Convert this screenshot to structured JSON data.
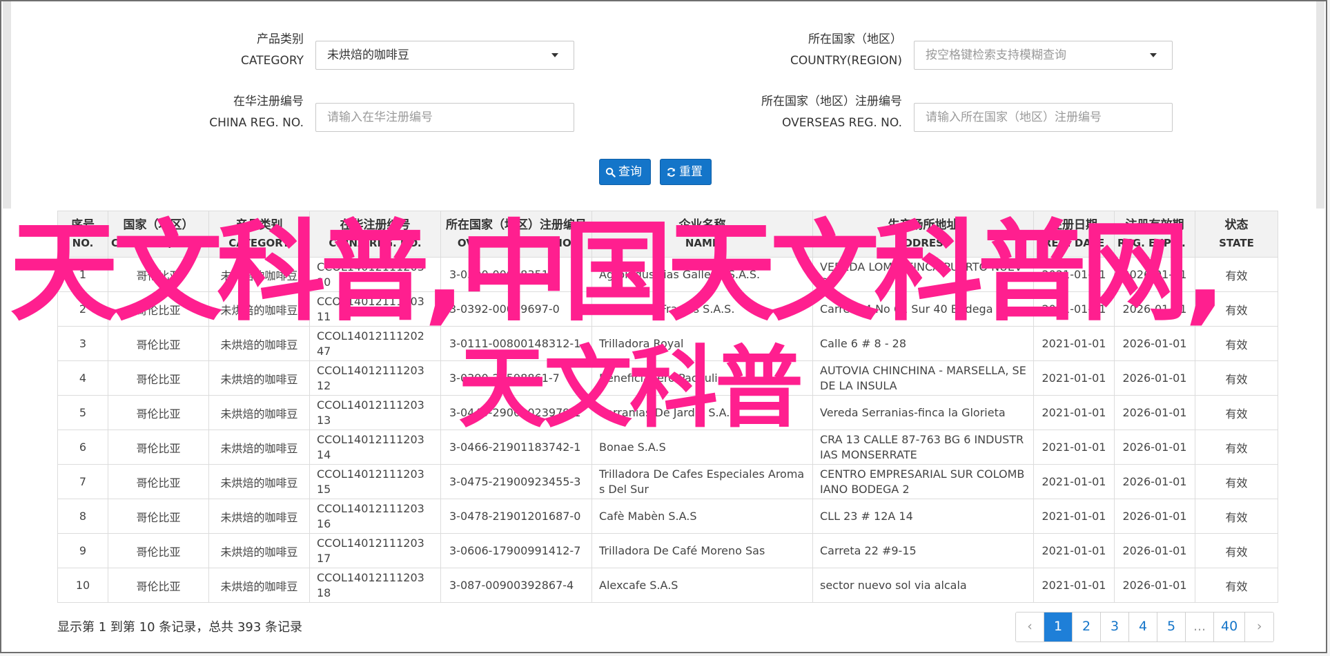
{
  "form": {
    "category": {
      "label_cn": "产品类别",
      "label_en": "CATEGORY",
      "value": "未烘焙的咖啡豆"
    },
    "country": {
      "label_cn": "所在国家（地区）",
      "label_en": "COUNTRY(REGION)",
      "placeholder": "按空格键检索支持模糊查询"
    },
    "china_reg": {
      "label_cn": "在华注册编号",
      "label_en": "CHINA REG. NO.",
      "placeholder": "请输入在华注册编号"
    },
    "overseas_reg": {
      "label_cn": "所在国家（地区）注册编号",
      "label_en": "OVERSEAS REG. NO.",
      "placeholder": "请输入所在国家（地区）注册编号"
    },
    "search_label": "查询",
    "reset_label": "重置"
  },
  "table": {
    "headers": [
      {
        "cn": "序号",
        "en": "NO."
      },
      {
        "cn": "国家（地区）",
        "en": "COUNTRY(REGIO..."
      },
      {
        "cn": "产品类别",
        "en": "CATEGORY"
      },
      {
        "cn": "在华注册编号",
        "en": "CHINA REG. NO."
      },
      {
        "cn": "所在国家（地区）注册编号",
        "en": "OVERSEAS REG. NO."
      },
      {
        "cn": "企业名称",
        "en": "NAME"
      },
      {
        "cn": "生产场所地址",
        "en": "ADDRESS"
      },
      {
        "cn": "注册日期",
        "en": "REG. DATE"
      },
      {
        "cn": "注册有效期",
        "en": "REG. EXPIRE ..."
      },
      {
        "cn": "状态",
        "en": "STATE"
      }
    ],
    "rows": [
      [
        "1",
        "哥伦比亚",
        "未烘焙的咖啡豆",
        "CCOL14012111203 10",
        "3-0390-00048351",
        "Agroindustrias Gallego S.A.S.",
        "VEREDA LOMA, FINCA PUERTO NUEVO",
        "2021-01-01",
        "2026-01-01",
        "有效"
      ],
      [
        "2",
        "哥伦比亚",
        "未烘焙的咖啡豆",
        "CCOL14012111203 11",
        "3-0392-00059697-0",
        "Cafes & St Francis S.A.S.",
        "Carrera 4 No 61 Sur 40 Bodega 5",
        "2021-01-01",
        "2026-01-01",
        "有效"
      ],
      [
        "3",
        "哥伦比亚",
        "未烘焙的咖啡豆",
        "CCOL14012111202 47",
        "3-0111-00800148312-1",
        "Trilladora Royal",
        "Calle 6 # 8 - 28",
        "2021-01-01",
        "2026-01-01",
        "有效"
      ],
      [
        "4",
        "哥伦比亚",
        "未烘焙的咖啡豆",
        "CCOL14012111203 12",
        "3-0390-20598861-7",
        "Beneficiadero Pachuli",
        "AUTOVIA CHINCHINA - MARSELLA, SEDE LA INSULA",
        "2021-01-01",
        "2026-01-01",
        "有效"
      ],
      [
        "5",
        "哥伦比亚",
        "未烘焙的咖啡豆",
        "CCOL14012111203 13",
        "3-0440-29001023979-1",
        "Serranias De Jardin S.A.S.",
        "Vereda Serranias-finca la Glorieta",
        "2021-01-01",
        "2026-01-01",
        "有效"
      ],
      [
        "6",
        "哥伦比亚",
        "未烘焙的咖啡豆",
        "CCOL14012111203 14",
        "3-0466-21901183742-1",
        "Bonae S.A.S",
        "CRA 13 CALLE 87-763 BG 6 INDUSTRIAS MONSERRATE",
        "2021-01-01",
        "2026-01-01",
        "有效"
      ],
      [
        "7",
        "哥伦比亚",
        "未烘焙的咖啡豆",
        "CCOL14012111203 15",
        "3-0475-21900923455-3",
        "Trilladora De Cafes Especiales Aromas Del Sur",
        "CENTRO EMPRESARIAL SUR COLOMBIANO BODEGA 2",
        "2021-01-01",
        "2026-01-01",
        "有效"
      ],
      [
        "8",
        "哥伦比亚",
        "未烘焙的咖啡豆",
        "CCOL14012111203 16",
        "3-0478-21901201687-0",
        "Cafè Mabèn S.A.S",
        "CLL 23 # 12A 14",
        "2021-01-01",
        "2026-01-01",
        "有效"
      ],
      [
        "9",
        "哥伦比亚",
        "未烘焙的咖啡豆",
        "CCOL14012111203 17",
        "3-0606-17900991412-7",
        "Trilladora De Café Moreno Sas",
        "Carreta 22 #9-15",
        "2021-01-01",
        "2026-01-01",
        "有效"
      ],
      [
        "10",
        "哥伦比亚",
        "未烘焙的咖啡豆",
        "CCOL14012111203 18",
        "3-087-00900392867-4",
        "Alexcafe S.A.S",
        "sector nuevo sol via alcala",
        "2021-01-01",
        "2026-01-01",
        "有效"
      ]
    ]
  },
  "footer": {
    "summary": "显示第 1 到第 10 条记录，总共 393 条记录",
    "pages": [
      "‹",
      "1",
      "2",
      "3",
      "4",
      "5",
      "...",
      "40",
      "›"
    ],
    "active_page": "1"
  },
  "watermark": {
    "line1": "天文科普,中国天文科普网,",
    "line2": "天文科普"
  },
  "colors": {
    "primary": "#1475c9",
    "watermark": "#ff1f8f"
  }
}
